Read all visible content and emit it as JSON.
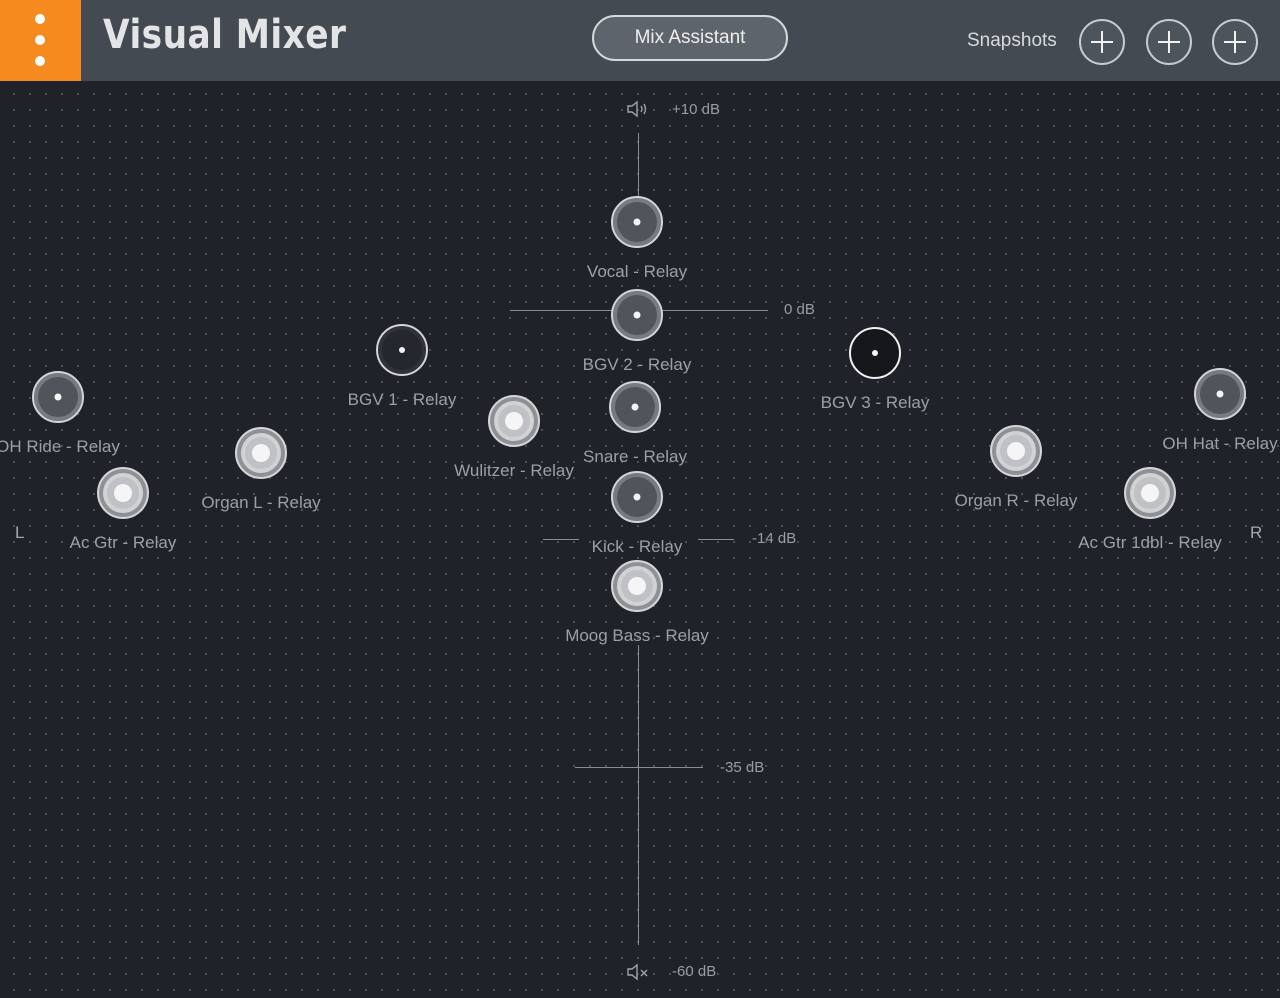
{
  "header": {
    "title": "Visual Mixer",
    "mix_assistant_label": "Mix Assistant",
    "snapshots_label": "Snapshots"
  },
  "icons": {
    "menu": "kebab-menu-icon",
    "snapshot_add": "plus-icon",
    "speaker_on": "speaker-volume-icon",
    "speaker_mute": "speaker-mute-icon"
  },
  "colors": {
    "accent": "#f58a1f",
    "header_bg": "#434a52",
    "stage_bg": "#1f2229"
  },
  "scale": {
    "top": "+10 dB",
    "zero": "0 dB",
    "minus14": "-14 dB",
    "minus35": "-35 dB",
    "bottom": "-60 dB",
    "left": "L",
    "right": "R"
  },
  "tracks": [
    {
      "label": "Vocal - Relay"
    },
    {
      "label": "BGV 2 - Relay"
    },
    {
      "label": "BGV 1 - Relay"
    },
    {
      "label": "BGV 3 - Relay"
    },
    {
      "label": "OH Ride - Relay"
    },
    {
      "label": "OH Hat - Relay"
    },
    {
      "label": "Wulitzer - Relay"
    },
    {
      "label": "Snare - Relay"
    },
    {
      "label": "Organ L - Relay"
    },
    {
      "label": "Organ R - Relay"
    },
    {
      "label": "Ac Gtr - Relay"
    },
    {
      "label": "Ac Gtr 1dbl - Relay"
    },
    {
      "label": "Kick - Relay"
    },
    {
      "label": "Moog Bass - Relay"
    }
  ]
}
